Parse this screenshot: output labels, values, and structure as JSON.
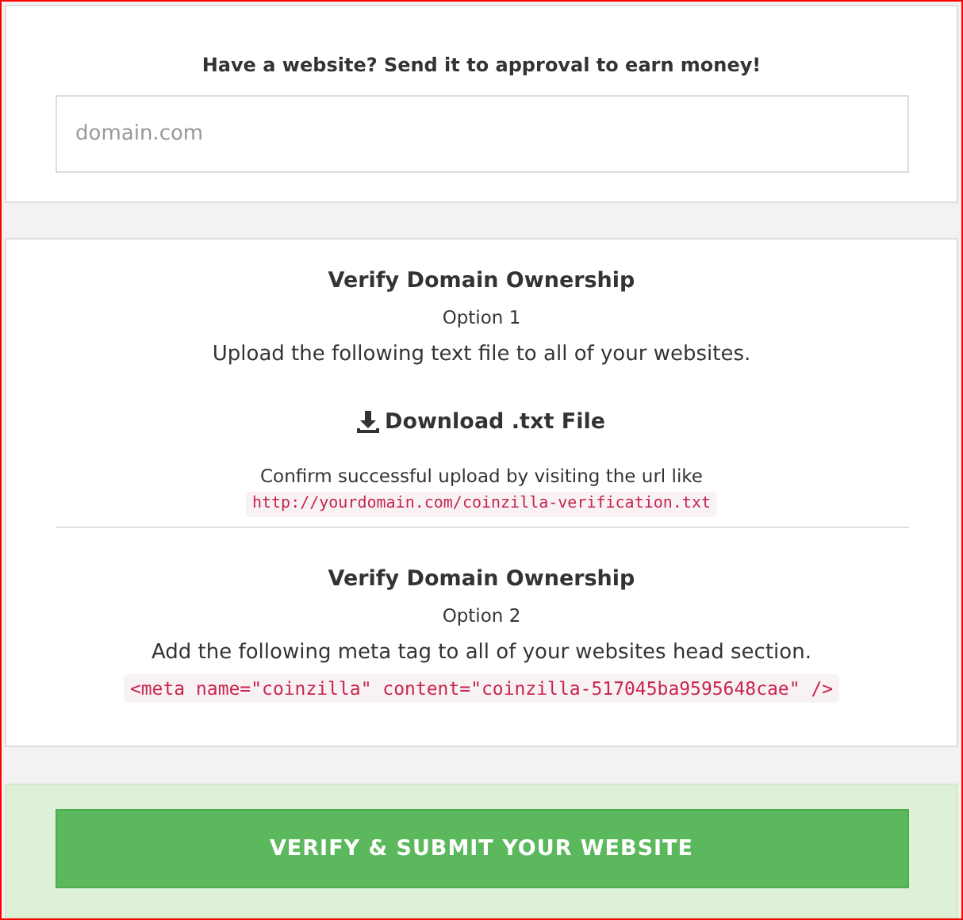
{
  "submit_card": {
    "heading": "Have a website? Send it to approval to earn money!",
    "domain_field": {
      "placeholder": "domain.com"
    }
  },
  "verify_card": {
    "options": [
      {
        "title": "Verify Domain Ownership",
        "option": "Option 1",
        "instruction": "Upload the following text file to all of your websites.",
        "download_link": "Download .txt File",
        "confirm_note": "Confirm successful upload by visiting the url like",
        "code": "http://yourdomain.com/coinzilla-verification.txt"
      },
      {
        "title": "Verify Domain Ownership",
        "option": "Option 2",
        "instruction": "Add the following meta tag to all of your websites head section.",
        "code": "<meta name=\"coinzilla\" content=\"coinzilla-517045ba9595648cae\" />"
      }
    ]
  },
  "submit_button": "VERIFY & SUBMIT YOUR WEBSITE"
}
